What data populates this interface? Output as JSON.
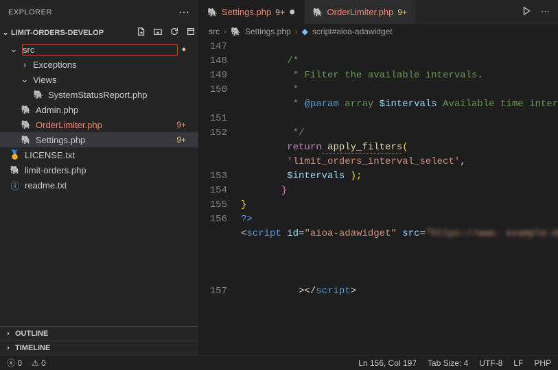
{
  "explorer": {
    "title": "EXPLORER",
    "project": "LIMIT-ORDERS-DEVELOP",
    "tree": {
      "src": "src",
      "exceptions": "Exceptions",
      "views": "Views",
      "systemStatus": "SystemStatusReport.php",
      "admin": "Admin.php",
      "orderLimiter": "OrderLimiter.php",
      "orderLimiterBadge": "9+",
      "settings": "Settings.php",
      "settingsBadge": "9+",
      "license": "LICENSE.txt",
      "limitOrders": "limit-orders.php",
      "readme": "readme.txt"
    },
    "outline": "OUTLINE",
    "timeline": "TIMELINE"
  },
  "tabs": {
    "t1": {
      "name": "Settings.php",
      "mod": "9+"
    },
    "t2": {
      "name": "OrderLimiter.php",
      "mod": "9+"
    }
  },
  "breadcrumb": {
    "p1": "src",
    "p2": "Settings.php",
    "p3": "script#aioa-adawidget"
  },
  "lines": {
    "l147": "147",
    "l148": "148",
    "l149": "149",
    "l150": "150",
    "l151": "151",
    "l152": "152",
    "l153": "153",
    "l154": "154",
    "l155": "155",
    "l156": "156",
    "l157": "157"
  },
  "code": {
    "c147b": "/*",
    "c148": "     * Filter the available intervals.",
    "c149": "     *",
    "c150a": "     * ",
    "c150b": "@param",
    "c150c": " array",
    "c150d": " $intervals",
    "c150e": " Available time intervals.",
    "c151": "     */",
    "c152ret": "return",
    "c152func": " apply_filters",
    "c152open": "(",
    "c152str": " 'limit_orders_interval_select'",
    "c152comma": ",",
    "c152var": " $intervals",
    "c152close": " );",
    "c153": "   }",
    "c154": "}",
    "c155": "?>",
    "c156lt": "<",
    "c156tag": "script",
    "c156id": " id",
    "c156eq1": "=",
    "c156idval": "\"aioa-adawidget\"",
    "c156src": " src",
    "c156eq2": "=",
    "c156blur": "\"https://www. example-domain.com/accessibility/ all-in-one-accessibility-js-widget-minify.js? colorcode=420000token=At.d.11026311072414940& position=\"",
    "c156gt": ">",
    "c156close1": "</",
    "c156close2": "script",
    "c156close3": ">"
  },
  "status": {
    "errors": "0",
    "warnings": "0",
    "pos": "Ln 156, Col 197",
    "tab": "Tab Size: 4",
    "enc": "UTF-8",
    "eol": "LF",
    "lang": "PHP"
  }
}
